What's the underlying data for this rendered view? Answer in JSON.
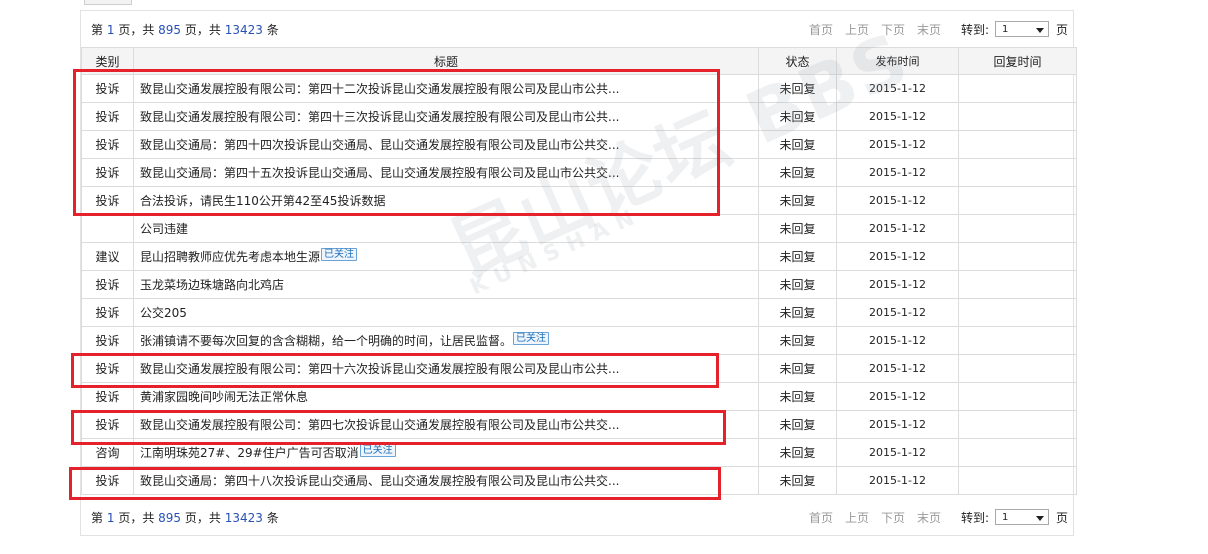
{
  "pager": {
    "prefix": "第",
    "page": "1",
    "mid1": "页，共",
    "total_pages": "895",
    "mid2": "页，共",
    "total_items": "13423",
    "suffix": "条",
    "first": "首页",
    "prev": "上页",
    "next": "下页",
    "last": "末页",
    "goto_label": "转到:",
    "goto_value": "1",
    "goto_unit": "页"
  },
  "columns": {
    "category": "类别",
    "title": "标题",
    "status": "状态",
    "published": "发布时间",
    "reply_time": "回复时间"
  },
  "rows": [
    {
      "category": "投诉",
      "title": "致昆山交通发展控股有限公司：第四十二次投诉昆山交通发展控股有限公司及昆山市公共...",
      "tag": "",
      "status": "未回复",
      "date": "2015-1-12",
      "reply": ""
    },
    {
      "category": "投诉",
      "title": "致昆山交通发展控股有限公司：第四十三次投诉昆山交通发展控股有限公司及昆山市公共...",
      "tag": "",
      "status": "未回复",
      "date": "2015-1-12",
      "reply": ""
    },
    {
      "category": "投诉",
      "title": "致昆山交通局：第四十四次投诉昆山交通局、昆山交通发展控股有限公司及昆山市公共交...",
      "tag": "",
      "status": "未回复",
      "date": "2015-1-12",
      "reply": ""
    },
    {
      "category": "投诉",
      "title": "致昆山交通局：第四十五次投诉昆山交通局、昆山交通发展控股有限公司及昆山市公共交...",
      "tag": "",
      "status": "未回复",
      "date": "2015-1-12",
      "reply": ""
    },
    {
      "category": "投诉",
      "title": "合法投诉，请民生110公开第42至45投诉数据",
      "tag": "",
      "status": "未回复",
      "date": "2015-1-12",
      "reply": ""
    },
    {
      "category": "",
      "title": "公司违建",
      "tag": "",
      "status": "未回复",
      "date": "2015-1-12",
      "reply": ""
    },
    {
      "category": "建议",
      "title": "昆山招聘教师应优先考虑本地生源",
      "tag": "已关注",
      "status": "未回复",
      "date": "2015-1-12",
      "reply": ""
    },
    {
      "category": "投诉",
      "title": "玉龙菜场边珠塘路向北鸡店",
      "tag": "",
      "status": "未回复",
      "date": "2015-1-12",
      "reply": ""
    },
    {
      "category": "投诉",
      "title": "公交205",
      "tag": "",
      "status": "未回复",
      "date": "2015-1-12",
      "reply": ""
    },
    {
      "category": "投诉",
      "title": "张浦镇请不要每次回复的含含糊糊，给一个明确的时间，让居民监督。",
      "tag": "已关注",
      "status": "未回复",
      "date": "2015-1-12",
      "reply": ""
    },
    {
      "category": "投诉",
      "title": "致昆山交通发展控股有限公司：第四十六次投诉昆山交通发展控股有限公司及昆山市公共...",
      "tag": "",
      "status": "未回复",
      "date": "2015-1-12",
      "reply": ""
    },
    {
      "category": "投诉",
      "title": "黄浦家园晚间吵闹无法正常休息",
      "tag": "",
      "status": "未回复",
      "date": "2015-1-12",
      "reply": ""
    },
    {
      "category": "投诉",
      "title": "致昆山交通发展控股有限公司：第四七次投诉昆山交通发展控股有限公司及昆山市公共交...",
      "tag": "",
      "status": "未回复",
      "date": "2015-1-12",
      "reply": ""
    },
    {
      "category": "咨询",
      "title": "江南明珠苑27#、29#住户广告可否取消",
      "tag": "已关注",
      "status": "未回复",
      "date": "2015-1-12",
      "reply": ""
    },
    {
      "category": "投诉",
      "title": "致昆山交通局：第四十八次投诉昆山交通局、昆山交通发展控股有限公司及昆山市公共交...",
      "tag": "",
      "status": "未回复",
      "date": "2015-1-12",
      "reply": ""
    }
  ],
  "watermark": {
    "main": "昆山论坛 BBS",
    "sub": "KUNSHAN"
  },
  "colors": {
    "highlight": "#e5222c",
    "page_number": "#2650b8",
    "nav_disabled": "#9a9a9a",
    "tag": "#1f6fb8"
  }
}
